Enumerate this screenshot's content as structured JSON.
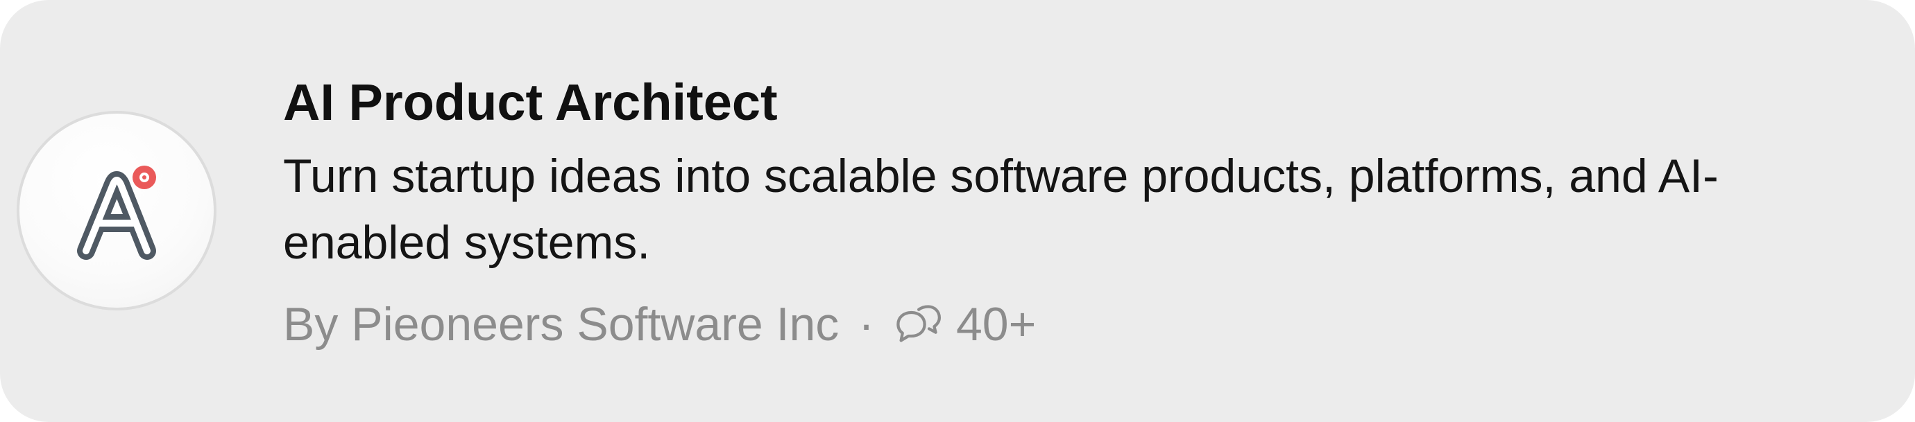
{
  "gpt_card": {
    "title": "AI Product Architect",
    "description": "Turn startup ideas into scalable software products, platforms, and AI-enabled systems.",
    "author": "By Pieoneers Software Inc",
    "separator": "·",
    "conversation_count": "40+",
    "icons": {
      "avatar": "product-architect-logo-icon",
      "conversations": "chat-bubbles-icon"
    },
    "colors": {
      "background": "#ececec",
      "title": "#101010",
      "muted": "#8c8c8c",
      "accent": "#ea5a5a"
    }
  }
}
